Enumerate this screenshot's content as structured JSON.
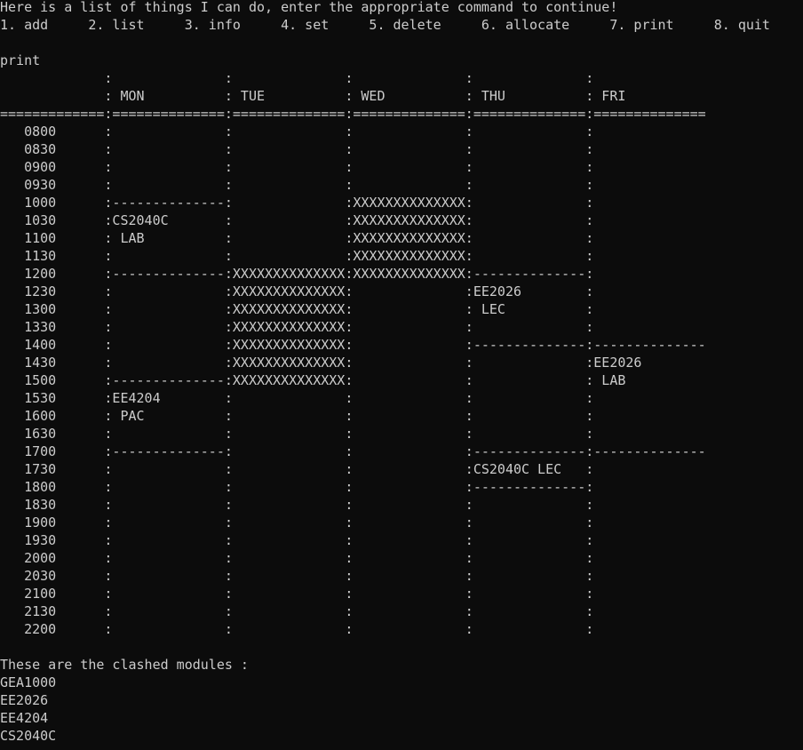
{
  "terminal": {
    "lines": [
      "Here is a list of things I can do, enter the appropriate command to continue!",
      "1. add     2. list     3. info     4. set     5. delete     6. allocate     7. print     8. quit",
      "",
      "print",
      "             :              :              :              :              :",
      "             : MON          : TUE          : WED          : THU          : FRI",
      "=============:==============:==============:==============:==============:==============",
      "   0800      :              :              :              :              :",
      "   0830      :              :              :              :              :",
      "   0900      :              :              :              :              :",
      "   0930      :              :              :              :              :",
      "   1000      :--------------:              :XXXXXXXXXXXXXX:              :",
      "   1030      :CS2040C       :              :XXXXXXXXXXXXXX:              :",
      "   1100      : LAB          :              :XXXXXXXXXXXXXX:              :",
      "   1130      :              :              :XXXXXXXXXXXXXX:              :",
      "   1200      :--------------:XXXXXXXXXXXXXX:XXXXXXXXXXXXXX:--------------:",
      "   1230      :              :XXXXXXXXXXXXXX:              :EE2026        :",
      "   1300      :              :XXXXXXXXXXXXXX:              : LEC          :",
      "   1330      :              :XXXXXXXXXXXXXX:              :              :",
      "   1400      :              :XXXXXXXXXXXXXX:              :--------------:--------------",
      "   1430      :              :XXXXXXXXXXXXXX:              :              :EE2026",
      "   1500      :--------------:XXXXXXXXXXXXXX:              :              : LAB",
      "   1530      :EE4204        :              :              :              :",
      "   1600      : PAC          :              :              :              :",
      "   1630      :              :              :              :              :",
      "   1700      :--------------:              :              :--------------:--------------",
      "   1730      :              :              :              :CS2040C LEC   :",
      "   1800      :              :              :              :--------------:",
      "   1830      :              :              :              :              :",
      "   1900      :              :              :              :              :",
      "   1930      :              :              :              :              :",
      "   2000      :              :              :              :              :",
      "   2030      :              :              :              :              :",
      "   2100      :              :              :              :              :",
      "   2130      :              :              :              :              :",
      "   2200      :              :              :              :              :",
      "",
      "These are the clashed modules :",
      "GEA1000",
      "EE2026",
      "EE4204",
      "CS2040C"
    ]
  }
}
